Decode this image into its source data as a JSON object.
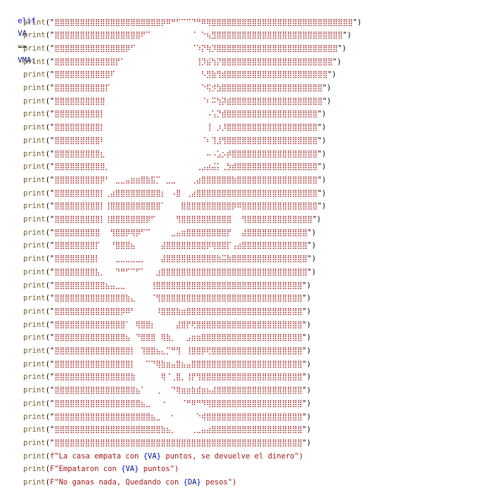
{
  "colors": {
    "keyword": "#0000ff",
    "function": "#795e26",
    "identifier": "#001080",
    "string": "#a31515",
    "background": "#ffffff"
  },
  "header": {
    "keyword": "elif",
    "left": "VA",
    "operator": "==",
    "right": "VMA",
    "colon": ":"
  },
  "print_fn": "print",
  "ascii_art_lines": [
    "⣿⣿⣿⣿⣿⣿⣿⣿⣿⣿⣿⣿⣿⣿⣿⣿⣿⣿⣿⣿⣿⡿⠿⠛⠋⠉⠉⠙⠛⠿⢿⣿⣿⣿⣿⣿⣿⣿⣿⣿⣿⣿⣿⣿⣿⣿⣿⣿⣿⣿⣿⣿⣿⣿⣿⣿⣿⣿⣿",
    "⣿⣿⣿⣿⣿⣿⣿⣿⣿⣿⣿⣿⣿⣿⣿⣿⣿⠟⠉⠀⠀⠀⠀⠀⠀⠀⠀⠈⠀⠑⢦⣻⣿⣿⣿⣿⣿⣿⣿⣿⣿⣿⣿⣿⣿⣿⣿⣿⣿⣿⣿⣿⣿⣿⣿⣿⣿",
    "⣿⣿⣿⣿⣿⣿⣿⣿⣿⣿⣿⣿⣿⣿⡿⠋⠀⠀⠀⠀⠀⠀⠀⠀⠀⠀⠀⠈⠱⡝⢷⡹⣿⣿⣿⣿⣿⣿⣿⣿⣿⣿⣿⣿⣿⣿⣿⣿⣿⣿⣿⣿⣿⣿⣿⣿",
    "⣿⣿⣿⣿⣿⣿⣿⣿⣿⣿⣿⣿⡟⠁⠀⠀⠀⠀⠀⠀⠀⠀⠀⠀⠀⠀⠀⠀⢸⡹⣮⢳⡝⣿⣿⣿⣿⣿⣿⣿⣿⣿⣿⣿⣿⣿⣿⣿⣿⣿⣿⣿⣿⣿⣿",
    "⣿⣿⣿⣿⣿⣿⣿⣿⣿⣿⣿⠏⠀⠀⠀⠀⠀⠀⠀⠀⠀⠀⠀⠀⠀⠀⠀⠀⠀⠣⣻⣷⢻⣾⣿⣿⣿⣿⣿⣿⣿⣿⣿⣿⣿⣿⣿⣿⣿⣿⣿⣿⣿⣿",
    "⣿⣿⣿⣿⣿⣿⣿⣿⣿⣿⡏⠀⠀⠀⠀⠀⠀⠀⠀⠀⠀⠀⠀⠀⠀⠀⠀⠀⠀⠑⢯⡺⣳⣿⣿⣿⣿⣿⣿⣿⣿⣿⣿⣿⣿⣿⣿⣿⣿⣿⣿⣿⣿",
    "⣿⣿⣿⣿⣿⣿⣿⣿⣿⣿⠀⠀⠀⠀⠀⠀⠀⠀⠀⠀⠀⠀⠀⠀⠀⠀⠀⠀⠀⠈⠆⠭⢳⡽⣾⣿⣿⣿⣿⣿⣿⣿⣿⣿⣿⣿⣿⣿⣿⣿⣿⣿⣿",
    "⣿⣿⣿⣿⣿⣿⣿⣿⣿⡇⠀⠀⠀⠀⠀⠀⠀⠀⠀⠀⠀⠀⠀⠀⠀⠀⠀⠀⠀⠀⠠⢡⡙⣾⣿⣿⣿⣿⣿⣿⣿⣿⣿⣿⣿⣿⣿⣿⣿⣿⣿⣿",
    "⣿⣿⣿⣿⣿⣿⣿⣿⣿⡇⠀⠀⠀⠀⠀⠀⠀⠀⠀⠀⠀⠀⠀⠀⠀⠀⠀⠀⠀⠀⢸⠀⡰⡸⣿⣿⣿⣿⣿⣿⣿⣿⣿⣿⣿⣿⣿⣿⣿⣿⣿⣿",
    "⣿⣿⣿⣿⣿⣿⣿⣿⣿⠇⠀⠀⠀⠀⠀⠀⠀⠀⠀⠀⠀⠀⠀⠀⠀⠀⠀⠀⠀⠈⠆⢹⣸⢻⣿⣿⣿⣿⣿⣿⣿⣿⣿⣿⣿⣿⣿⣿⣿⣿⣿⣿",
    "⣿⣿⣿⣿⣿⣿⣿⣿⣿⣆⠀⠀⠀⠀⠀⠀⠀⠀⠀⠀⠀⠀⠀⠀⠀⠀⠀⠀⠀⠀⠤⠠⣡⡢⡾⣿⣿⣿⣿⣿⣿⣿⣿⣿⣿⣿⣿⣿⣿⣿⣿⣿",
    "⣿⣿⣿⣿⣿⣿⣿⣿⣿⣿⡀⠀⠀⠀⠀⠀⠀⠀⠀⠀⠀⠀⠀⠀⠀⠀⠀⠀⢀⣠⣴⣬⡅⢀⣳⣾⣿⣿⣿⣿⣿⣿⣿⣿⣿⣿⣿⣿⣿⣿⣿⣿",
    "⣿⣿⣿⣿⣿⣿⣿⣿⣿⡿⠃⠀⣀⣀⣤⣶⣶⣿⣷⣯⡉⠀⣀⣀⠀⠀⠀⢀⣴⣿⣿⣿⣿⣿⣿⣷⣿⣿⣿⣿⣿⣿⣿⣿⣿⣿⣿⣿⣿⣿⣿⣿",
    "⣿⣿⣿⣿⣿⣿⣿⣿⣿⡇⢀⣴⣿⣿⣿⣿⣿⣿⣿⣿⣿⡆⠀⠠⣿⠀⢀⣴⣿⣿⣿⣿⣿⣿⣿⣿⣿⣿⣿⣿⣿⣿⣿⣿⣿⣿⣿⣿⣿⣿⣿⣿",
    "⣿⣿⣿⣿⣿⣿⣿⣿⣿⡇⢸⣿⣿⣿⣿⣿⣿⣿⣿⣿⣿⠁⠀⠀⠀⣿⣿⣿⣿⣿⣿⣿⣿⣿⣿⡿⠿⣿⣿⣿⣿⣿⣿⣿⣿⣿⣿⣿⣿⣿⣿⣿",
    "⣿⣿⣿⣿⣿⣿⣿⣿⣿⡇⢸⣿⣿⣿⣿⣿⣿⣿⡿⠋⠀⠀⠀⠀⢻⣿⣿⣿⣿⣿⣿⣿⣿⣿⣿⠀⠀⢻⣿⣿⣿⣿⣿⣿⣿⣿⣿⣿⣿⣿⣿",
    "⣿⣿⣿⣿⣿⣿⣿⣿⣿⠀⠀⢻⣿⣿⡿⢿⡿⠋⠉⠀⠀⠀⠀⣀⣤⣶⣿⣿⣿⣿⣿⣿⣿⣿⡟⠀⠀⣼⣿⣿⣿⣿⣿⣿⣿⣿⣿⣿⣿⣿",
    "⣿⣿⣿⣿⣿⣿⣿⣿⡏⠀⠀⠘⣿⣿⣿⣦⠀⠀⠀⠀⠀⣼⣿⣿⣿⣿⣿⣿⣿⣿⡿⢿⣿⣿⡏⢠⣴⣿⣿⣿⣿⣿⣿⣿⣿⣿⣿⣿⣿⣿",
    "⣿⣿⣿⣿⣿⣿⣿⣿⡇⠀⠀⠀⣀⣀⣀⣀⣀⡀⠀⠀⠀⣼⣿⣿⣿⣿⣿⣿⣿⣿⣿⣿⣷⣭⣷⣿⣿⣿⣿⣿⣿⣿⣿⣿⣿⣿⣿⣿⣿⣿",
    "⣿⣿⣿⣿⣿⣿⣿⣿⣧⡀⠀⠀⠙⠛⠋⠉⠋⠁⠀⠀⣰⣿⣿⣿⣿⣿⣿⣿⣿⣿⣿⣿⣿⣿⣿⣿⣿⣿⣿⣿⣿⣿⣿⣿⣿⣿⣿⣿⣿⣿",
    "⣿⣿⣿⣿⣿⣿⣿⣿⣿⣿⣦⣤⣀⣀⠀⠀⠀⠀⠀⢸⣿⣿⣿⣿⣿⣿⣿⣿⣿⣿⣿⣿⣿⣿⣿⣿⣿⣿⣿⣿⣿⣿⣿⣿⣿⣿⣿⣿⣿",
    "⣿⣿⣿⣿⣿⣿⣿⣿⣿⣿⣿⣿⣿⣿⣷⣄⠀⠀⠀⠈⢻⣿⣿⣿⣿⣿⣿⣿⣿⣿⣿⣿⣿⣿⣿⣿⣿⣿⣿⣿⣿⣿⣿⣿⣿⣿⣿⣿⣿",
    "⣿⣿⣿⣿⣿⣿⣿⣿⣿⣿⣿⣿⣿⡿⠿⠃⠀⠀⠀⠀⠸⣿⣿⣿⣷⣶⣿⣿⣿⣿⣿⣿⣿⣿⣿⣿⣿⣿⣿⣿⣿⣿⣿⣿⣿⣿⣿⣿⣿",
    "⣿⣿⣿⣿⣿⣿⣿⣿⣿⣿⣿⣿⣿⣿⠁⠀⢿⣿⣿⡆⠀⠀⠀⠀⣼⣿⡟⢟⣿⣿⣿⣿⣿⣿⣿⣿⣿⣿⣿⣿⣿⣿⣿⣿⣿⣿⣿⣿⣿",
    "⣿⣿⣿⣿⣿⣿⣿⣿⣿⣿⣿⣿⣿⣿⣦⠀⠙⣿⣿⣿⠀⢿⣷⡀⠀⠀⣠⣶⣶⣿⣿⣿⣿⣿⣿⣿⣿⣿⣿⣿⣿⣿⣿⣿⣿⣿⣿⣿⣿",
    "⣿⣿⣿⣿⣿⣿⣿⣿⣿⣿⣿⣿⣿⣿⣿⡇⠀⢹⣿⣿⣦⣄⡉⠛⢻⠀⢸⣿⣿⡿⢟⣿⣿⣿⣿⣿⣿⣿⣿⣿⣿⣿⣿⣿⣿⣿⣿⣿⣿",
    "⣿⣿⣿⣿⣿⣿⣿⣿⣿⣿⣿⣿⣿⣿⣿⡇⠀⠀⠉⠙⢿⣷⣶⣤⣿⣦⣤⣿⣿⣿⣿⣿⣿⣿⣿⣿⣿⣿⣿⣿⣿⣿⣿⣿⣿⣿⣿⣿⣿",
    "⣿⣿⣿⣿⣿⣿⣿⣿⣿⣿⣿⣿⣿⣿⣿⣷⠀⠀⠀⠀⠀⢿⠈⢀⣿⡀⢸⡟⢻⣿⣿⣿⣿⣿⣿⣿⣿⣿⣿⣿⣿⣿⣿⣿⣿⣿⣿⣿⣿",
    "⣿⣿⣿⣿⣿⣿⣿⣿⣿⣿⣿⣿⣿⣿⣿⣿⣦⠁⠀⠀⢀⠀⠀⠙⢿⣶⣶⣷⣾⣶⣦⣼⣿⣿⣿⣿⣿⣿⣿⣿⣿⣿⣿⣿⣿⣿⣿⣿⣿",
    "⣿⣿⣿⣿⣿⣿⣿⣿⣿⣿⣿⣿⣿⣿⣿⣿⣿⣦⣀⠀⠀⠐⠀⠀⠀⠈⠛⠿⠛⠻⢿⣿⣿⣿⣿⣿⣿⣿⣿⣿⣿⣿⣿⣿⣿⣿⣿⣿⣿",
    "⣿⣿⣿⣿⣿⣿⣿⣿⣿⣿⣿⣿⣿⣿⣿⣿⣿⣿⣿⣦⣀⠀⠀⠂⠀⠀⠀⠀⠑⢾⣿⣿⣿⣿⣿⣿⣿⣿⣿⣿⣿⣿⣿⣿⣿⣿⣿⣿⣿",
    "⣿⣿⣿⣿⣿⣿⣿⣿⣿⣿⣿⣿⣿⣿⣿⣿⣿⣿⣿⣿⣿⣷⣦⡀⠀⠀⠀⢀⣀⣤⣴⣿⣿⣿⣿⣿⣿⣿⣿⣿⣿⣿⣿⣿⣿⣿⣿⣿⣿",
    "⣿⣿⣿⣿⣿⣿⣿⣿⣿⣿⣿⣿⣿⣿⣿⣿⣿⣿⣿⣿⣿⣿⣿⣿⣿⣿⣿⣿⣿⣿⣿⣿⣿⣿⣿⣿⣿⣿⣿⣿⣿⣿⣿⣿⣿⣿⣿⣿⣿"
  ],
  "messages": [
    {
      "prefix": "f\"",
      "parts": [
        "La casa empata con ",
        "VA",
        " puntos, se devuelve el dinero"
      ]
    },
    {
      "prefix": "F\"",
      "parts": [
        "Empataron con ",
        "VA",
        " puntos"
      ]
    },
    {
      "prefix": "F\"",
      "parts": [
        "No ganas nada, Quedando con ",
        "DA",
        " pesos"
      ]
    }
  ]
}
